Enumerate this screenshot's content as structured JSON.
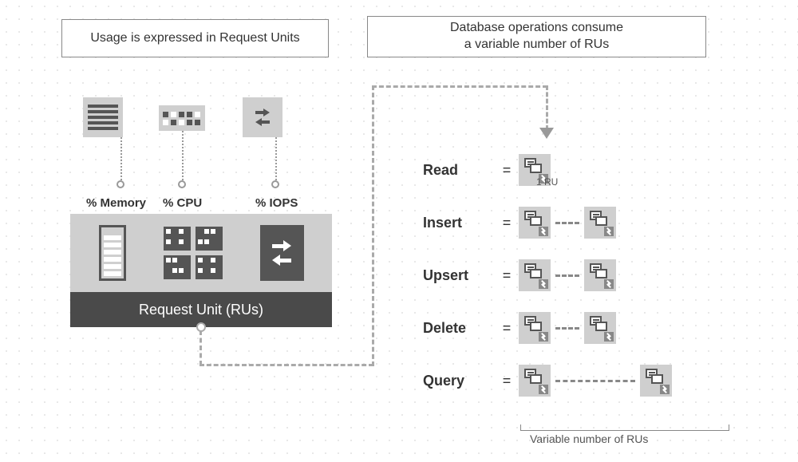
{
  "headers": {
    "left": "Usage is expressed in Request Units",
    "right": "Database operations consume\na variable number of RUs"
  },
  "resources": {
    "memory": "% Memory",
    "cpu": "% CPU",
    "iops": "% IOPS"
  },
  "ru_box_label": "Request Unit (RUs)",
  "operations": [
    {
      "name": "Read",
      "ru_count": 1,
      "variable": false,
      "note": "1 RU"
    },
    {
      "name": "Insert",
      "ru_count": 2,
      "variable": true,
      "gap": "short"
    },
    {
      "name": "Upsert",
      "ru_count": 2,
      "variable": true,
      "gap": "short"
    },
    {
      "name": "Delete",
      "ru_count": 2,
      "variable": true,
      "gap": "short"
    },
    {
      "name": "Query",
      "ru_count": 2,
      "variable": true,
      "gap": "long"
    }
  ],
  "footer": "Variable number of RUs",
  "equals": "="
}
